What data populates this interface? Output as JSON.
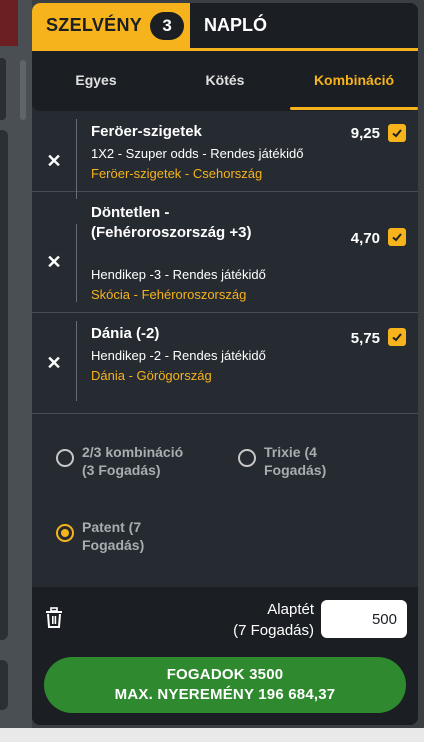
{
  "tabs": {
    "slip_label": "SZELVÉNY",
    "slip_count": "3",
    "log_label": "NAPLÓ"
  },
  "subtabs": [
    {
      "label": "Egyes"
    },
    {
      "label": "Kötés"
    },
    {
      "label": "Kombináció",
      "active": true
    }
  ],
  "bets": [
    {
      "title_lines": [
        "Feröer-szigetek"
      ],
      "market": "1X2 - Szuper odds - Rendes játékidő",
      "event": "Feröer-szigetek - Csehország",
      "odds": "9,25"
    },
    {
      "title_lines": [
        "Döntetlen -",
        "(Fehéroroszország +3)"
      ],
      "market": "Hendikep -3 - Rendes játékidő",
      "event": "Skócia - Fehéroroszország",
      "odds": "4,70"
    },
    {
      "title_lines": [
        "Dánia (-2)"
      ],
      "market": "Hendikep -2 - Rendes játékidő",
      "event": "Dánia - Görögország",
      "odds": "5,75"
    }
  ],
  "options": [
    {
      "lines": [
        "2/3 kombináció",
        "(3 Fogadás)"
      ],
      "selected": false
    },
    {
      "lines": [
        "Trixie (4",
        "Fogadás)"
      ],
      "selected": false
    },
    {
      "lines": [
        "Patent (7",
        "Fogadás)"
      ],
      "selected": true
    }
  ],
  "stake": {
    "label_line1": "Alaptét",
    "label_line2": "(7 Fogadás)",
    "value": "500"
  },
  "place_button": {
    "line1": "FOGADOK 3500",
    "line2": "MAX. NYEREMÉNY 196 684,37"
  },
  "colors": {
    "accent": "#f6b31b",
    "panel": "#252b31",
    "dark": "#1b1f23",
    "button_green": "#2f8a2f"
  },
  "icons": {
    "remove": "close-icon",
    "selected": "checkbox-checked-icon",
    "trash": "trash-icon"
  }
}
